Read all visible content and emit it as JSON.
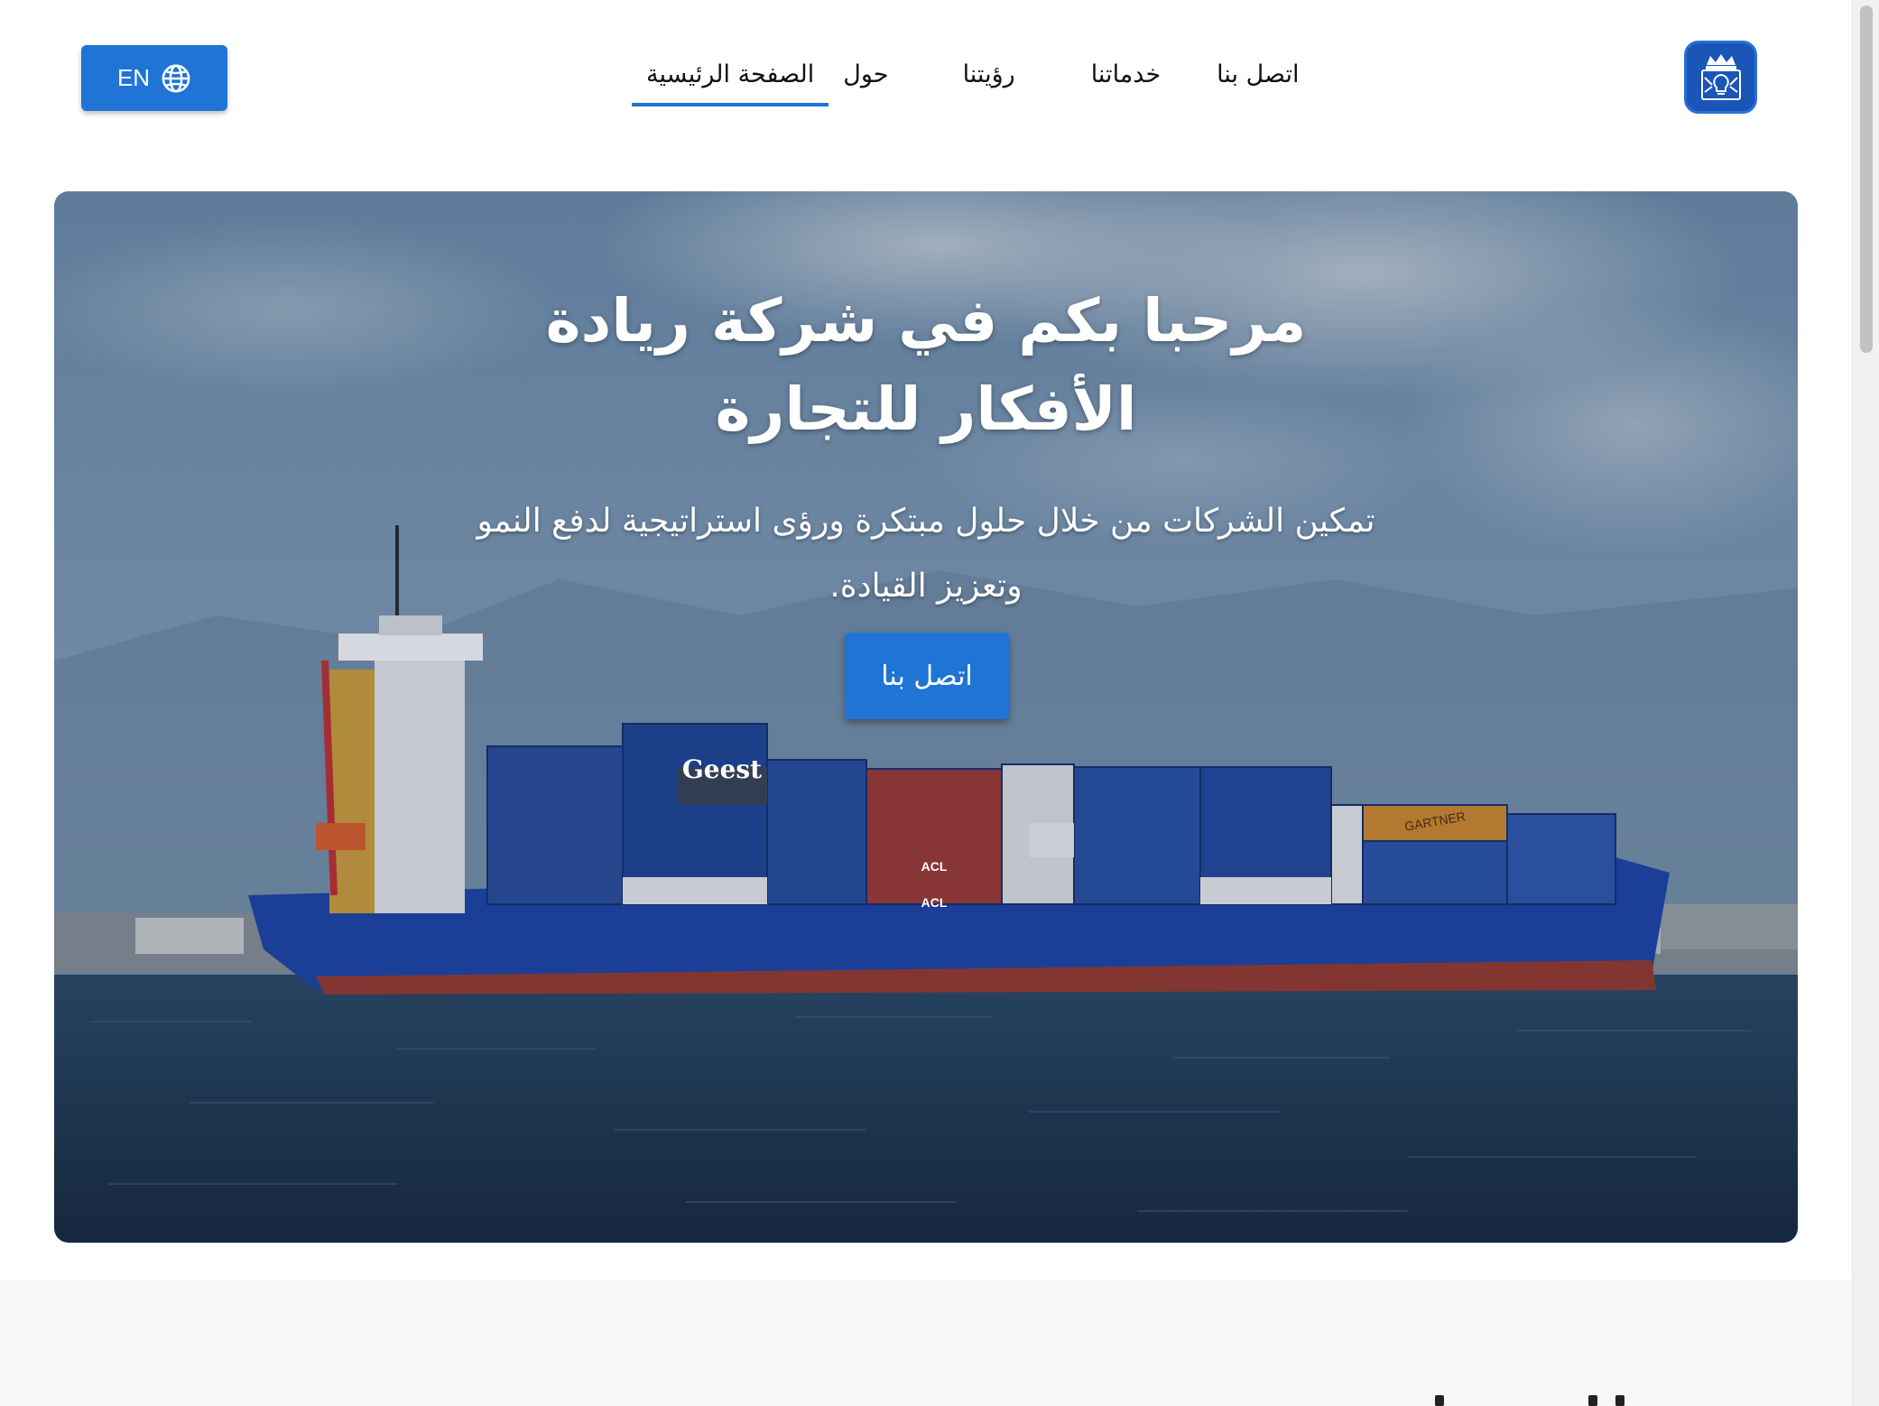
{
  "header": {
    "lang_label": "EN",
    "nav": [
      {
        "label": "الصفحة الرئيسية",
        "active": true
      },
      {
        "label": "حول",
        "active": false
      },
      {
        "label": "رؤيتنا",
        "active": false
      },
      {
        "label": "خدماتنا",
        "active": false
      },
      {
        "label": "اتصل بنا",
        "active": false
      }
    ]
  },
  "hero": {
    "title": "مرحبا بكم في شركة ريادة الأفكار للتجارة",
    "subtitle": "تمكين الشركات من خلال حلول مبتكرة ورؤى استراتيجية لدفع النمو وتعزيز القيادة.",
    "cta_label": "اتصل بنا",
    "container_labels": [
      "Geest",
      "GARTNER",
      "ACL",
      "ACL"
    ]
  },
  "colors": {
    "accent": "#1f74d6",
    "logo_bg": "#1a55b8",
    "ship_hull": "#1d45a8",
    "sea": "#213a52"
  }
}
